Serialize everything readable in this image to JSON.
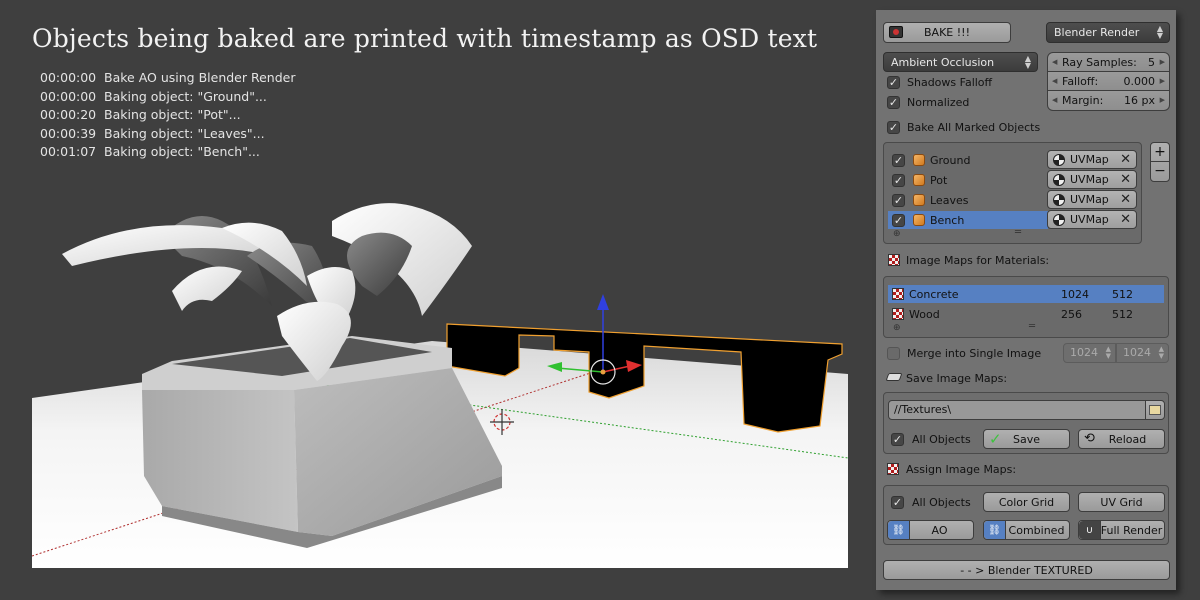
{
  "overlay": {
    "title": "Objects being baked are printed with timestamp as OSD text",
    "osd_log": [
      {
        "time": "00:00:00",
        "message": "Bake AO using Blender Render"
      },
      {
        "time": "00:00:00",
        "message": "Baking object: \"Ground\"..."
      },
      {
        "time": "00:00:20",
        "message": "Baking object: \"Pot\"..."
      },
      {
        "time": "00:00:39",
        "message": "Baking object: \"Leaves\"..."
      },
      {
        "time": "00:01:07",
        "message": "Baking object: \"Bench\"..."
      }
    ]
  },
  "viewport": {
    "objects": [
      "Ground",
      "Pot",
      "Leaves",
      "Bench"
    ],
    "selected_object": "Bench",
    "colors": {
      "selection_outline": "#f0a030",
      "x_axis": "#e03030",
      "y_axis": "#30c030",
      "z_axis": "#3040e0"
    }
  },
  "panel": {
    "bake_button": "BAKE !!!",
    "bake_icon": "camera-icon",
    "render_engine": "Blender Render",
    "bake_type": "Ambient Occlusion",
    "shadows_falloff": {
      "label": "Shadows Falloff",
      "checked": true
    },
    "normalized": {
      "label": "Normalized",
      "checked": true
    },
    "ray_samples": {
      "label": "Ray Samples:",
      "value": "5"
    },
    "falloff": {
      "label": "Falloff:",
      "value": "0.000"
    },
    "margin": {
      "label": "Margin:",
      "value": "16 px"
    },
    "bake_all_marked": {
      "label": "Bake All Marked Objects",
      "checked": true
    },
    "objects": [
      {
        "name": "Ground",
        "checked": true,
        "uvmap": "UVMap",
        "selected": false
      },
      {
        "name": "Pot",
        "checked": true,
        "uvmap": "UVMap",
        "selected": false
      },
      {
        "name": "Leaves",
        "checked": true,
        "uvmap": "UVMap",
        "selected": false
      },
      {
        "name": "Bench",
        "checked": true,
        "uvmap": "UVMap",
        "selected": true
      }
    ],
    "add_button": "+",
    "remove_button": "−",
    "image_maps_header": "Image Maps for Materials:",
    "image_maps": [
      {
        "name": "Concrete",
        "width": "1024",
        "height": "512",
        "selected": true
      },
      {
        "name": "Wood",
        "width": "256",
        "height": "512",
        "selected": false
      }
    ],
    "merge": {
      "label": "Merge into Single Image",
      "checked": false,
      "width": "1024",
      "height": "1024"
    },
    "save_header": "Save Image Maps:",
    "save_path": "//Textures\\",
    "save_all_objects": {
      "label": "All Objects",
      "checked": true
    },
    "save_button": "Save",
    "reload_button": "Reload",
    "assign_header": "Assign Image Maps:",
    "assign_all_objects": {
      "label": "All Objects",
      "checked": true
    },
    "color_grid_button": "Color Grid",
    "uv_grid_button": "UV Grid",
    "ao_button": "AO",
    "combined_button": "Combined",
    "full_render_button": "Full Render",
    "textured_button": "- - > Blender TEXTURED",
    "accent_color": "#5680c2"
  }
}
